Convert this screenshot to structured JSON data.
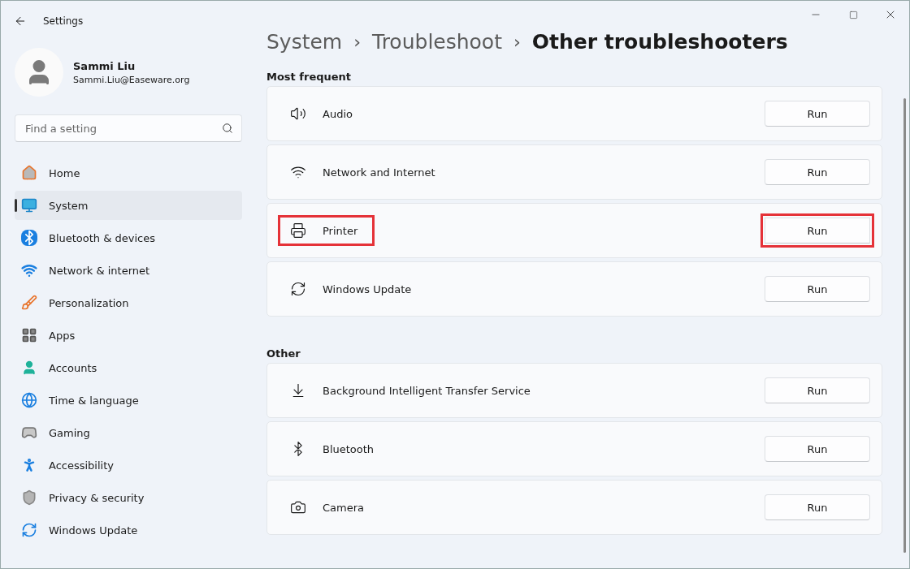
{
  "window": {
    "title": "Settings"
  },
  "profile": {
    "name": "Sammi Liu",
    "email": "Sammi.Liu@Easeware.org"
  },
  "search": {
    "placeholder": "Find a setting"
  },
  "sidebar": {
    "items": [
      {
        "label": "Home",
        "selected": false
      },
      {
        "label": "System",
        "selected": true
      },
      {
        "label": "Bluetooth & devices",
        "selected": false
      },
      {
        "label": "Network & internet",
        "selected": false
      },
      {
        "label": "Personalization",
        "selected": false
      },
      {
        "label": "Apps",
        "selected": false
      },
      {
        "label": "Accounts",
        "selected": false
      },
      {
        "label": "Time & language",
        "selected": false
      },
      {
        "label": "Gaming",
        "selected": false
      },
      {
        "label": "Accessibility",
        "selected": false
      },
      {
        "label": "Privacy & security",
        "selected": false
      },
      {
        "label": "Windows Update",
        "selected": false
      }
    ]
  },
  "breadcrumb": [
    {
      "label": "System",
      "current": false
    },
    {
      "label": "Troubleshoot",
      "current": false
    },
    {
      "label": "Other troubleshooters",
      "current": true
    }
  ],
  "breadcrumb_separator": "›",
  "sections": [
    {
      "title": "Most frequent",
      "rows": [
        {
          "label": "Audio",
          "button": "Run",
          "highlighted": false
        },
        {
          "label": "Network and Internet",
          "button": "Run",
          "highlighted": false
        },
        {
          "label": "Printer",
          "button": "Run",
          "highlighted": true
        },
        {
          "label": "Windows Update",
          "button": "Run",
          "highlighted": false
        }
      ]
    },
    {
      "title": "Other",
      "rows": [
        {
          "label": "Background Intelligent Transfer Service",
          "button": "Run",
          "highlighted": false
        },
        {
          "label": "Bluetooth",
          "button": "Run",
          "highlighted": false
        },
        {
          "label": "Camera",
          "button": "Run",
          "highlighted": false
        }
      ]
    }
  ]
}
